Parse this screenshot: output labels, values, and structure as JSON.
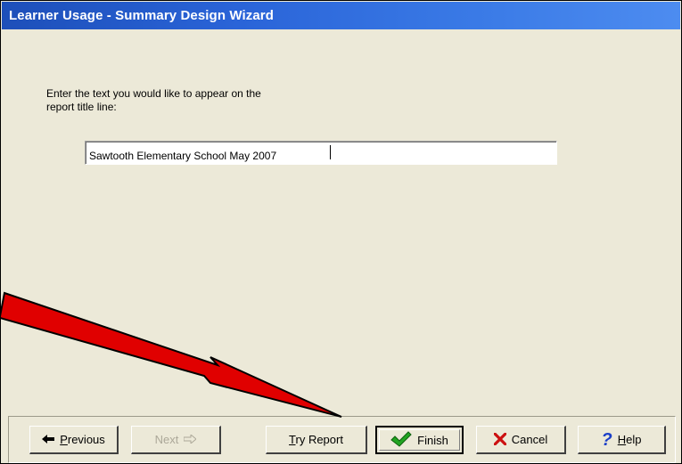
{
  "window": {
    "title": "Learner Usage - Summary Design Wizard"
  },
  "prompt": {
    "line1": "Enter the text you would like to appear on the",
    "line2": "report title line:"
  },
  "title_field": {
    "value": "Sawtooth Elementary School May 2007"
  },
  "buttons": {
    "previous": {
      "mnemonic": "P",
      "rest": "revious",
      "enabled": true,
      "icon": "left-arrow-icon"
    },
    "next": {
      "label": "Next",
      "enabled": false,
      "icon": "right-arrow-icon"
    },
    "try_report": {
      "mnemonic": "T",
      "rest": "ry Report",
      "enabled": true
    },
    "finish": {
      "label": "Finish",
      "enabled": true,
      "default": true,
      "icon": "green-checkmark-icon"
    },
    "cancel": {
      "label": "Cancel",
      "enabled": true,
      "icon": "red-x-icon"
    },
    "help": {
      "mnemonic": "H",
      "rest": "elp",
      "enabled": true,
      "icon": "blue-question-mark-icon"
    }
  },
  "colors": {
    "titlebar": "#2a64d8",
    "dialog_bg": "#ece9d8",
    "annotation_arrow": "#e00000"
  }
}
